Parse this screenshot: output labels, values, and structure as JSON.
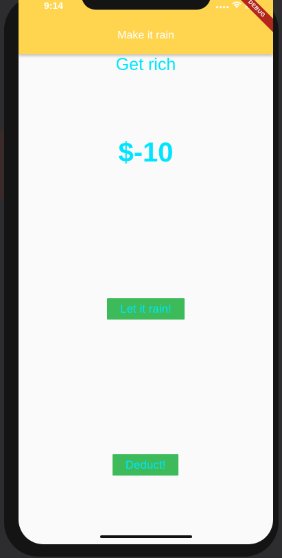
{
  "status_bar": {
    "time": "9:14",
    "icons": [
      "signal-icon",
      "wifi-icon",
      "battery-icon"
    ]
  },
  "debug_banner": "DEBUG",
  "app_bar": {
    "title": "Make it rain",
    "color": "#ffd54f"
  },
  "main": {
    "heading": "Get rich",
    "amount": "$-10",
    "text_color": "#00e5ff",
    "buttons": {
      "rain_label": "Let it rain!",
      "deduct_label": "Deduct!",
      "color": "#3dba5a"
    }
  }
}
